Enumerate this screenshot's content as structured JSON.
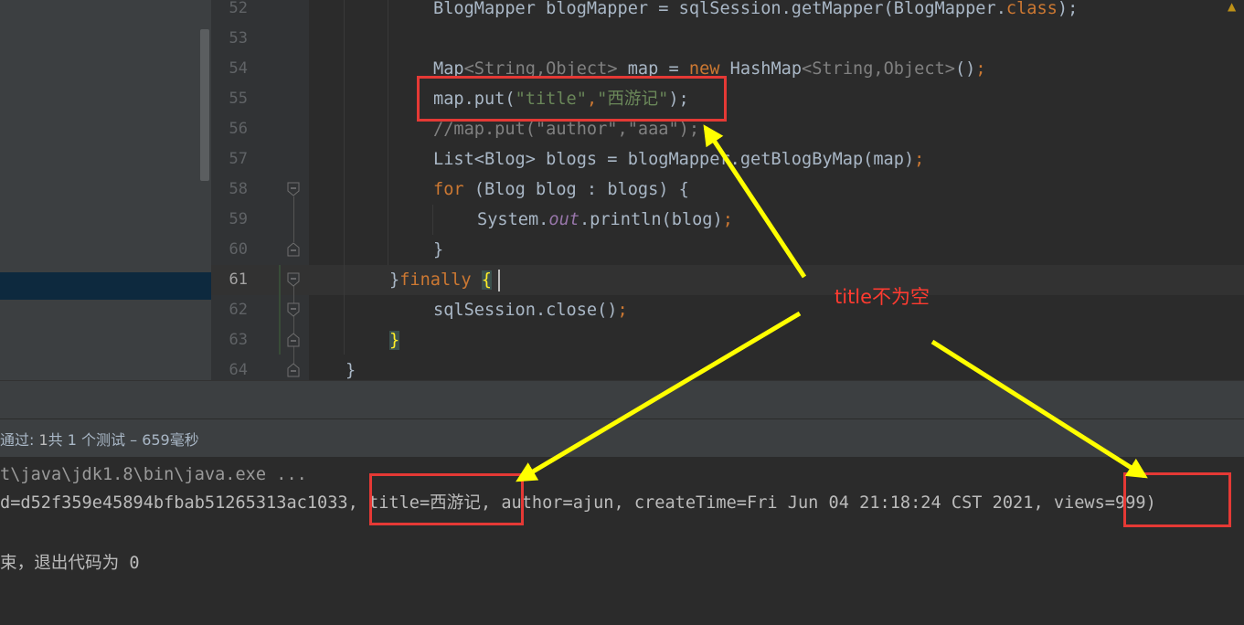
{
  "editor": {
    "line_numbers": [
      "52",
      "53",
      "54",
      "55",
      "56",
      "57",
      "58",
      "59",
      "60",
      "61",
      "62",
      "63",
      "64"
    ],
    "lines": {
      "l52": [
        "BlogMapper blogMapper = sqlSession.getMapper(BlogMapper.",
        "class",
        ");"
      ],
      "l54": [
        "Map",
        "<String,Object>",
        " map = ",
        "new",
        " HashMap",
        "<String,Object>",
        "()",
        ";"
      ],
      "l55": [
        "map.put(",
        "\"title\"",
        ",",
        "\"西游记\"",
        ");"
      ],
      "l56": "//map.put(\"author\",\"aaa\");",
      "l57": [
        "List<Blog> blogs = blogMapper.getBlogByMap(map)",
        ";"
      ],
      "l58": [
        "for",
        " (Blog blog : blogs) {"
      ],
      "l59": [
        "System.",
        "out",
        ".println(blog)",
        ";"
      ],
      "l60": "}",
      "l61": [
        "}",
        "finally",
        " ",
        "{"
      ],
      "l62": [
        "sqlSession.close()",
        ";"
      ],
      "l63": "}",
      "l64": "}"
    }
  },
  "test_panel": {
    "status_prefix": "通过: ",
    "status_count": "1",
    "status_rest": "共 1 个测试 – 659毫秒"
  },
  "console": {
    "line1": "t\\java\\jdk1.8\\bin\\java.exe ...",
    "line2": "d=d52f359e45894bfbab51265313ac1033, title=西游记, author=ajun, createTime=Fri Jun 04 21:18:24 CST 2021, views=999)",
    "line3": "束，退出代码为 0"
  },
  "annotation": {
    "label": "title不为空"
  },
  "colors": {
    "keyword": "#cc7832",
    "string": "#6a8759",
    "annotation_red": "#e53935",
    "arrow_yellow": "#ffff00"
  }
}
